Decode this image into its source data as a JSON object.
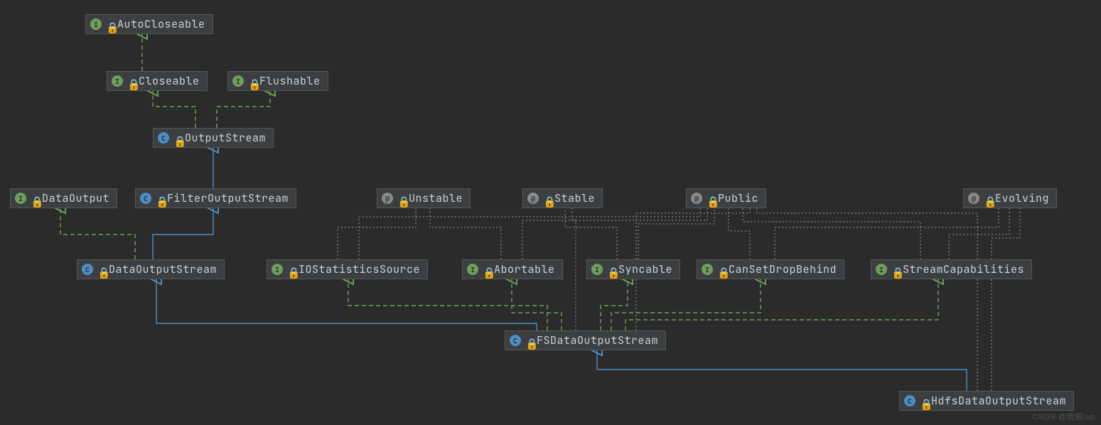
{
  "watermark": "CSDN @我很ruo",
  "nodes": {
    "autoCloseable": {
      "kind": "interface",
      "label": "AutoCloseable"
    },
    "closeable": {
      "kind": "interface",
      "label": "Closeable"
    },
    "flushable": {
      "kind": "interface",
      "label": "Flushable"
    },
    "outputStream": {
      "kind": "class",
      "label": "OutputStream"
    },
    "dataOutput": {
      "kind": "interface",
      "label": "DataOutput"
    },
    "filterOutputStream": {
      "kind": "class",
      "label": "FilterOutputStream"
    },
    "unstable": {
      "kind": "annotation",
      "label": "Unstable"
    },
    "stable": {
      "kind": "annotation",
      "label": "Stable"
    },
    "public": {
      "kind": "annotation",
      "label": "Public"
    },
    "evolving": {
      "kind": "annotation",
      "label": "Evolving"
    },
    "dataOutputStream": {
      "kind": "class",
      "label": "DataOutputStream"
    },
    "ioStatisticsSource": {
      "kind": "interface",
      "label": "IOStatisticsSource"
    },
    "abortable": {
      "kind": "interface",
      "label": "Abortable"
    },
    "syncable": {
      "kind": "interface",
      "label": "Syncable"
    },
    "canSetDropBehind": {
      "kind": "interface",
      "label": "CanSetDropBehind"
    },
    "streamCapabilities": {
      "kind": "interface",
      "label": "StreamCapabilities"
    },
    "fsDataOutputStream": {
      "kind": "class",
      "label": "FSDataOutputStream"
    },
    "hdfsDataOutputStream": {
      "kind": "class",
      "label": "HdfsDataOutputStream"
    }
  },
  "chart_data": {
    "type": "diagram",
    "title": "Java class/interface hierarchy (UML)",
    "edge_styles": {
      "extends": "blue solid open-triangle (class extends class)",
      "implements": "green dashed open-triangle (implements interface / interface extends interface)",
      "annotated": "gray dotted (annotated with)"
    },
    "edges": [
      {
        "from": "closeable",
        "to": "autoCloseable",
        "rel": "implements"
      },
      {
        "from": "outputStream",
        "to": "closeable",
        "rel": "implements"
      },
      {
        "from": "outputStream",
        "to": "flushable",
        "rel": "implements"
      },
      {
        "from": "filterOutputStream",
        "to": "outputStream",
        "rel": "extends"
      },
      {
        "from": "dataOutputStream",
        "to": "filterOutputStream",
        "rel": "extends"
      },
      {
        "from": "dataOutputStream",
        "to": "dataOutput",
        "rel": "implements"
      },
      {
        "from": "fsDataOutputStream",
        "to": "dataOutputStream",
        "rel": "extends"
      },
      {
        "from": "fsDataOutputStream",
        "to": "ioStatisticsSource",
        "rel": "implements"
      },
      {
        "from": "fsDataOutputStream",
        "to": "abortable",
        "rel": "implements"
      },
      {
        "from": "fsDataOutputStream",
        "to": "syncable",
        "rel": "implements"
      },
      {
        "from": "fsDataOutputStream",
        "to": "canSetDropBehind",
        "rel": "implements"
      },
      {
        "from": "fsDataOutputStream",
        "to": "streamCapabilities",
        "rel": "implements"
      },
      {
        "from": "hdfsDataOutputStream",
        "to": "fsDataOutputStream",
        "rel": "extends"
      },
      {
        "from": "ioStatisticsSource",
        "to": "unstable",
        "rel": "annotated"
      },
      {
        "from": "ioStatisticsSource",
        "to": "public",
        "rel": "annotated"
      },
      {
        "from": "abortable",
        "to": "unstable",
        "rel": "annotated"
      },
      {
        "from": "abortable",
        "to": "public",
        "rel": "annotated"
      },
      {
        "from": "syncable",
        "to": "stable",
        "rel": "annotated"
      },
      {
        "from": "syncable",
        "to": "public",
        "rel": "annotated"
      },
      {
        "from": "canSetDropBehind",
        "to": "public",
        "rel": "annotated"
      },
      {
        "from": "canSetDropBehind",
        "to": "evolving",
        "rel": "annotated"
      },
      {
        "from": "streamCapabilities",
        "to": "public",
        "rel": "annotated"
      },
      {
        "from": "streamCapabilities",
        "to": "evolving",
        "rel": "annotated"
      },
      {
        "from": "fsDataOutputStream",
        "to": "stable",
        "rel": "annotated"
      },
      {
        "from": "fsDataOutputStream",
        "to": "public",
        "rel": "annotated"
      },
      {
        "from": "hdfsDataOutputStream",
        "to": "public",
        "rel": "annotated"
      },
      {
        "from": "hdfsDataOutputStream",
        "to": "evolving",
        "rel": "annotated"
      }
    ]
  }
}
